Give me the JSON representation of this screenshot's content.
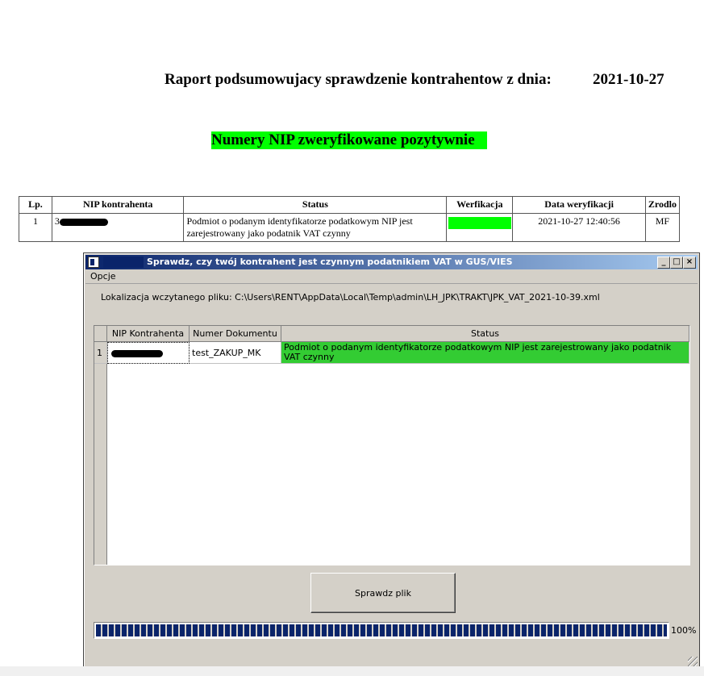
{
  "report": {
    "title": "Raport podsumowujacy sprawdzenie kontrahentow z dnia:",
    "date": "2021-10-27",
    "section_heading": "Numery NIP zweryfikowane pozytywnie",
    "columns": [
      "Lp.",
      "NIP kontrahenta",
      "Status",
      "Werfikacja",
      "Data weryfikacji",
      "Zrodlo"
    ],
    "rows": [
      {
        "lp": "1",
        "nip_prefix": "3",
        "status": "Podmiot o podanym identyfikatorze podatkowym NIP jest zarejestrowany jako podatnik VAT czynny",
        "verification_color": "#00ff00",
        "date": "2021-10-27 12:40:56",
        "source": "MF"
      }
    ]
  },
  "window": {
    "title": "Sprawdz, czy twój kontrahent jest czynnym podatnikiem VAT w GUS/VIES",
    "menu": [
      "Opcje"
    ],
    "file_path_text": "Lokalizacja wczytanego pliku: C:\\Users\\RENT\\AppData\\Local\\Temp\\admin\\LH_JPK\\TRAKT\\JPK_VAT_2021-10-39.xml",
    "grid": {
      "columns": [
        "NIP Kontrahenta",
        "Numer Dokumentu",
        "Status"
      ],
      "rows": [
        {
          "row_number": "1",
          "document": "test_ZAKUP_MK",
          "status": "Podmiot  o  podanym identyfikatorze  podatkowym  NIP  jest zarejestrowany jako podatnik VAT czynny"
        }
      ]
    },
    "check_button_label": "Sprawdz plik",
    "progress": {
      "value_percent": 100,
      "label": "100%"
    },
    "controls": {
      "minimize": "_",
      "maximize": "□",
      "close": "×"
    }
  }
}
